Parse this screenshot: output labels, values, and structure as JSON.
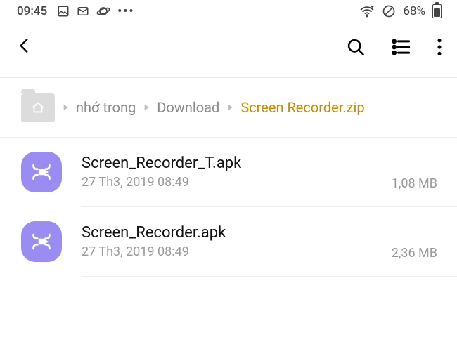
{
  "status": {
    "time": "09:45",
    "battery_text": "68%"
  },
  "breadcrumb": {
    "seg1": "nhớ trong",
    "seg2": "Download",
    "seg3": "Screen Recorder.zip"
  },
  "files": [
    {
      "name": "Screen_Recorder_T.apk",
      "meta": "27 Th3, 2019 08:49",
      "size": "1,08 MB"
    },
    {
      "name": "Screen_Recorder.apk",
      "meta": "27 Th3, 2019 08:49",
      "size": "2,36 MB"
    }
  ]
}
